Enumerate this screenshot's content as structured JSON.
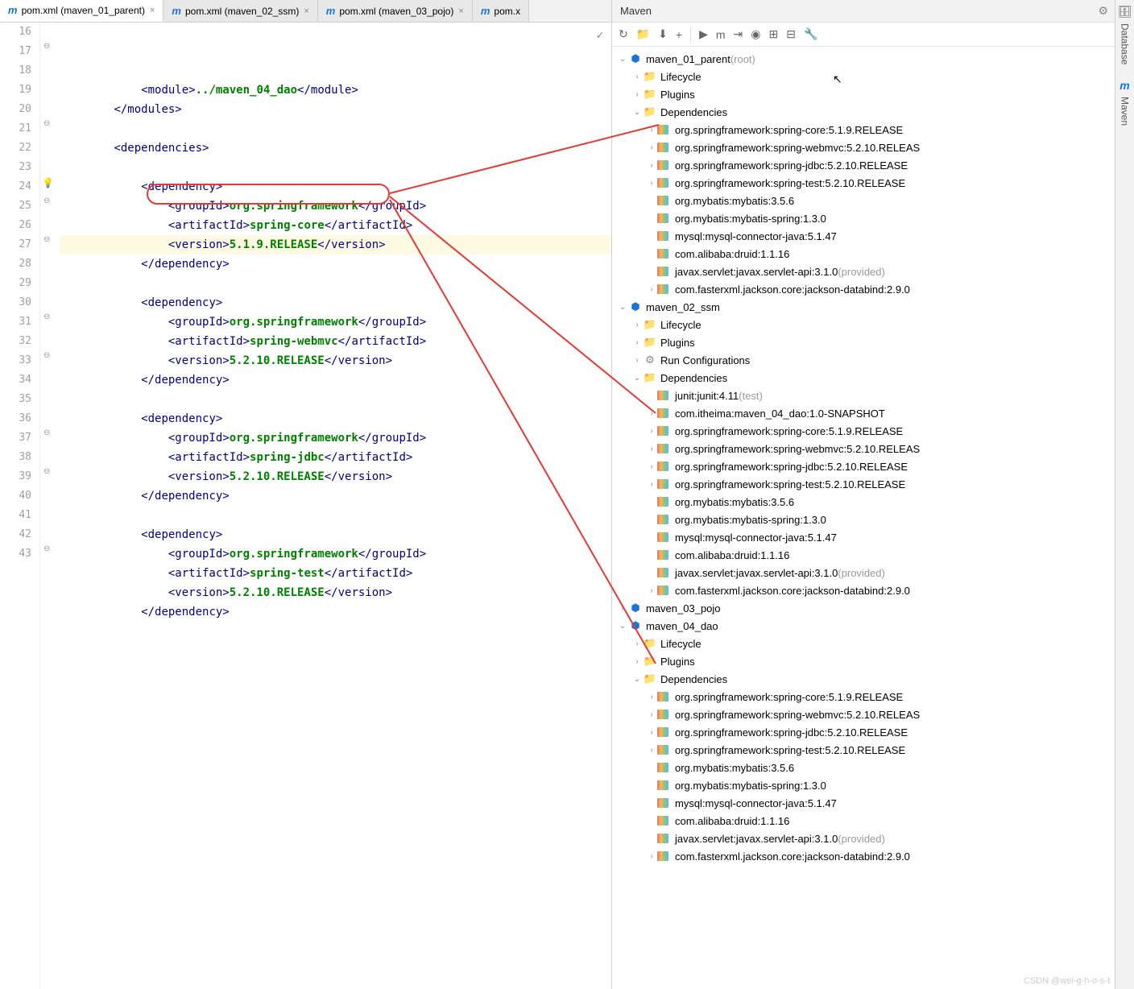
{
  "tabs": [
    {
      "icon": "m",
      "label": "pom.xml (maven_01_parent)",
      "active": true
    },
    {
      "icon": "m",
      "label": "pom.xml (maven_02_ssm)",
      "active": false
    },
    {
      "icon": "m",
      "label": "pom.xml (maven_03_pojo)",
      "active": false
    },
    {
      "icon": "m",
      "label": "pom.x",
      "active": false,
      "truncated": true
    }
  ],
  "lines": [
    {
      "n": 16,
      "indent": 12,
      "html": "<span class='tag'>&lt;module&gt;</span><span class='text'>../maven_04_dao</span><span class='tag'>&lt;/module&gt;</span>"
    },
    {
      "n": 17,
      "indent": 8,
      "html": "<span class='tag'>&lt;/modules&gt;</span>",
      "fold": true
    },
    {
      "n": 18,
      "indent": 0,
      "html": ""
    },
    {
      "n": 19,
      "indent": 8,
      "html": "<span class='tag'>&lt;dependencies&gt;</span>"
    },
    {
      "n": 20,
      "indent": 0,
      "html": ""
    },
    {
      "n": 21,
      "indent": 12,
      "html": "<span class='tag'>&lt;dependency&gt;</span>",
      "fold": true
    },
    {
      "n": 22,
      "indent": 16,
      "html": "<span class='tag'>&lt;groupId&gt;</span><span class='text'>org.springframework</span><span class='tag'>&lt;/groupId&gt;</span>"
    },
    {
      "n": 23,
      "indent": 16,
      "html": "<span class='tag'>&lt;artifactId&gt;</span><span class='text'>spring-core</span><span class='tag'>&lt;/artifactId&gt;</span>"
    },
    {
      "n": 24,
      "indent": 16,
      "html": "<span class='tag'>&lt;version&gt;</span><span class='text'>5.1.9.RELEASE</span><span class='tag'>&lt;/version&gt;</span>",
      "hl": true,
      "warn": true
    },
    {
      "n": 25,
      "indent": 12,
      "html": "<span class='tag'>&lt;/dependency&gt;</span>",
      "fold": true
    },
    {
      "n": 26,
      "indent": 0,
      "html": ""
    },
    {
      "n": 27,
      "indent": 12,
      "html": "<span class='tag'>&lt;dependency&gt;</span>",
      "fold": true
    },
    {
      "n": 28,
      "indent": 16,
      "html": "<span class='tag'>&lt;groupId&gt;</span><span class='text'>org.springframework</span><span class='tag'>&lt;/groupId&gt;</span>"
    },
    {
      "n": 29,
      "indent": 16,
      "html": "<span class='tag'>&lt;artifactId&gt;</span><span class='text'>spring-webmvc</span><span class='tag'>&lt;/artifactId&gt;</span>"
    },
    {
      "n": 30,
      "indent": 16,
      "html": "<span class='tag'>&lt;version&gt;</span><span class='text'>5.2.10.RELEASE</span><span class='tag'>&lt;/version&gt;</span>"
    },
    {
      "n": 31,
      "indent": 12,
      "html": "<span class='tag'>&lt;/dependency&gt;</span>",
      "fold": true
    },
    {
      "n": 32,
      "indent": 0,
      "html": ""
    },
    {
      "n": 33,
      "indent": 12,
      "html": "<span class='tag'>&lt;dependency&gt;</span>",
      "fold": true
    },
    {
      "n": 34,
      "indent": 16,
      "html": "<span class='tag'>&lt;groupId&gt;</span><span class='text'>org.springframework</span><span class='tag'>&lt;/groupId&gt;</span>"
    },
    {
      "n": 35,
      "indent": 16,
      "html": "<span class='tag'>&lt;artifactId&gt;</span><span class='text'>spring-jdbc</span><span class='tag'>&lt;/artifactId&gt;</span>"
    },
    {
      "n": 36,
      "indent": 16,
      "html": "<span class='tag'>&lt;version&gt;</span><span class='text'>5.2.10.RELEASE</span><span class='tag'>&lt;/version&gt;</span>"
    },
    {
      "n": 37,
      "indent": 12,
      "html": "<span class='tag'>&lt;/dependency&gt;</span>",
      "fold": true
    },
    {
      "n": 38,
      "indent": 0,
      "html": ""
    },
    {
      "n": 39,
      "indent": 12,
      "html": "<span class='tag'>&lt;dependency&gt;</span>",
      "fold": true
    },
    {
      "n": 40,
      "indent": 16,
      "html": "<span class='tag'>&lt;groupId&gt;</span><span class='text'>org.springframework</span><span class='tag'>&lt;/groupId&gt;</span>"
    },
    {
      "n": 41,
      "indent": 16,
      "html": "<span class='tag'>&lt;artifactId&gt;</span><span class='text'>spring-test</span><span class='tag'>&lt;/artifactId&gt;</span>"
    },
    {
      "n": 42,
      "indent": 16,
      "html": "<span class='tag'>&lt;version&gt;</span><span class='text'>5.2.10.RELEASE</span><span class='tag'>&lt;/version&gt;</span>"
    },
    {
      "n": 43,
      "indent": 12,
      "html": "<span class='tag'>&lt;/dependency&gt;</span>",
      "fold": true
    }
  ],
  "maven": {
    "title": "Maven",
    "toolbar": [
      "↻",
      "📁",
      "⬇",
      "+",
      "|",
      "▶",
      "m",
      "⇥",
      "◉",
      "⊞",
      "⊟",
      "🔧"
    ]
  },
  "tree": [
    {
      "d": 0,
      "a": "exp",
      "i": "module",
      "t": "maven_01_parent",
      "suf": "(root)"
    },
    {
      "d": 1,
      "a": "col",
      "i": "folder",
      "t": "Lifecycle"
    },
    {
      "d": 1,
      "a": "col",
      "i": "folder",
      "t": "Plugins"
    },
    {
      "d": 1,
      "a": "exp",
      "i": "folder",
      "t": "Dependencies"
    },
    {
      "d": 2,
      "a": "col",
      "i": "dep",
      "t": "org.springframework:spring-core:5.1.9.RELEASE"
    },
    {
      "d": 2,
      "a": "col",
      "i": "dep",
      "t": "org.springframework:spring-webmvc:5.2.10.RELEAS"
    },
    {
      "d": 2,
      "a": "col",
      "i": "dep",
      "t": "org.springframework:spring-jdbc:5.2.10.RELEASE"
    },
    {
      "d": 2,
      "a": "col",
      "i": "dep",
      "t": "org.springframework:spring-test:5.2.10.RELEASE"
    },
    {
      "d": 2,
      "a": "",
      "i": "dep",
      "t": "org.mybatis:mybatis:3.5.6"
    },
    {
      "d": 2,
      "a": "",
      "i": "dep",
      "t": "org.mybatis:mybatis-spring:1.3.0"
    },
    {
      "d": 2,
      "a": "",
      "i": "dep",
      "t": "mysql:mysql-connector-java:5.1.47"
    },
    {
      "d": 2,
      "a": "",
      "i": "dep",
      "t": "com.alibaba:druid:1.1.16"
    },
    {
      "d": 2,
      "a": "",
      "i": "dep",
      "t": "javax.servlet:javax.servlet-api:3.1.0",
      "suf": "(provided)"
    },
    {
      "d": 2,
      "a": "col",
      "i": "dep",
      "t": "com.fasterxml.jackson.core:jackson-databind:2.9.0"
    },
    {
      "d": 0,
      "a": "exp",
      "i": "module",
      "t": "maven_02_ssm"
    },
    {
      "d": 1,
      "a": "col",
      "i": "folder",
      "t": "Lifecycle"
    },
    {
      "d": 1,
      "a": "col",
      "i": "folder",
      "t": "Plugins"
    },
    {
      "d": 1,
      "a": "col",
      "i": "gear",
      "t": "Run Configurations"
    },
    {
      "d": 1,
      "a": "exp",
      "i": "folder",
      "t": "Dependencies"
    },
    {
      "d": 2,
      "a": "",
      "i": "dep",
      "t": "junit:junit:4.11",
      "suf": "(test)"
    },
    {
      "d": 2,
      "a": "col",
      "i": "dep",
      "t": "com.itheima:maven_04_dao:1.0-SNAPSHOT"
    },
    {
      "d": 2,
      "a": "col",
      "i": "dep",
      "t": "org.springframework:spring-core:5.1.9.RELEASE"
    },
    {
      "d": 2,
      "a": "col",
      "i": "dep",
      "t": "org.springframework:spring-webmvc:5.2.10.RELEAS"
    },
    {
      "d": 2,
      "a": "col",
      "i": "dep",
      "t": "org.springframework:spring-jdbc:5.2.10.RELEASE"
    },
    {
      "d": 2,
      "a": "col",
      "i": "dep",
      "t": "org.springframework:spring-test:5.2.10.RELEASE"
    },
    {
      "d": 2,
      "a": "",
      "i": "dep",
      "t": "org.mybatis:mybatis:3.5.6"
    },
    {
      "d": 2,
      "a": "",
      "i": "dep",
      "t": "org.mybatis:mybatis-spring:1.3.0"
    },
    {
      "d": 2,
      "a": "",
      "i": "dep",
      "t": "mysql:mysql-connector-java:5.1.47"
    },
    {
      "d": 2,
      "a": "",
      "i": "dep",
      "t": "com.alibaba:druid:1.1.16"
    },
    {
      "d": 2,
      "a": "",
      "i": "dep",
      "t": "javax.servlet:javax.servlet-api:3.1.0",
      "suf": "(provided)"
    },
    {
      "d": 2,
      "a": "col",
      "i": "dep",
      "t": "com.fasterxml.jackson.core:jackson-databind:2.9.0"
    },
    {
      "d": 0,
      "a": "col",
      "i": "module",
      "t": "maven_03_pojo"
    },
    {
      "d": 0,
      "a": "exp",
      "i": "module",
      "t": "maven_04_dao"
    },
    {
      "d": 1,
      "a": "col",
      "i": "folder",
      "t": "Lifecycle"
    },
    {
      "d": 1,
      "a": "col",
      "i": "folder",
      "t": "Plugins"
    },
    {
      "d": 1,
      "a": "exp",
      "i": "folder",
      "t": "Dependencies"
    },
    {
      "d": 2,
      "a": "col",
      "i": "dep",
      "t": "org.springframework:spring-core:5.1.9.RELEASE"
    },
    {
      "d": 2,
      "a": "col",
      "i": "dep",
      "t": "org.springframework:spring-webmvc:5.2.10.RELEAS"
    },
    {
      "d": 2,
      "a": "col",
      "i": "dep",
      "t": "org.springframework:spring-jdbc:5.2.10.RELEASE"
    },
    {
      "d": 2,
      "a": "col",
      "i": "dep",
      "t": "org.springframework:spring-test:5.2.10.RELEASE"
    },
    {
      "d": 2,
      "a": "",
      "i": "dep",
      "t": "org.mybatis:mybatis:3.5.6"
    },
    {
      "d": 2,
      "a": "",
      "i": "dep",
      "t": "org.mybatis:mybatis-spring:1.3.0"
    },
    {
      "d": 2,
      "a": "",
      "i": "dep",
      "t": "mysql:mysql-connector-java:5.1.47"
    },
    {
      "d": 2,
      "a": "",
      "i": "dep",
      "t": "com.alibaba:druid:1.1.16"
    },
    {
      "d": 2,
      "a": "",
      "i": "dep",
      "t": "javax.servlet:javax.servlet-api:3.1.0",
      "suf": "(provided)"
    },
    {
      "d": 2,
      "a": "col",
      "i": "dep",
      "t": "com.fasterxml.jackson.core:jackson-databind:2.9.0"
    }
  ],
  "sidebar": [
    {
      "icon": "🗄",
      "label": "Database"
    },
    {
      "icon": "m",
      "label": "Maven",
      "style": "maven"
    }
  ],
  "watermark": "CSDN @wei-g-h-o-s-t"
}
